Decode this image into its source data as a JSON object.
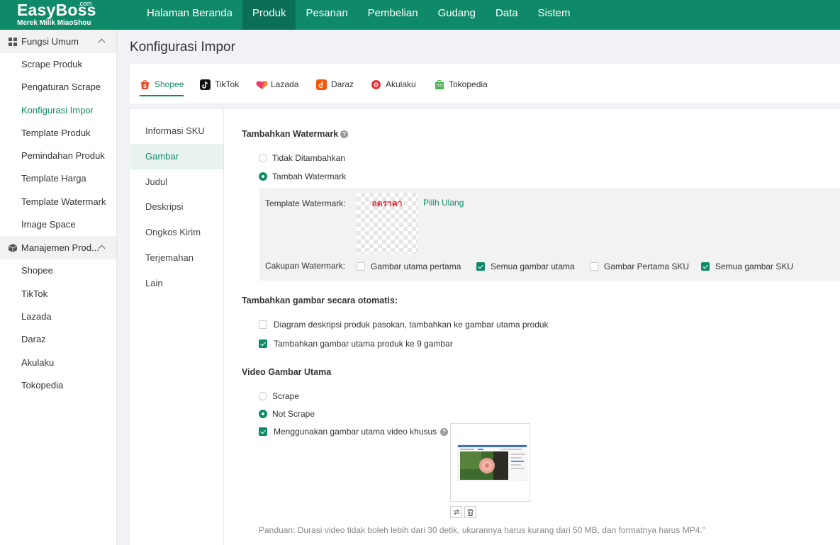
{
  "brand": {
    "name": "EasyBoss",
    "com": ".com",
    "subtitle": "Merek Milik MiaoShou"
  },
  "nav": [
    "Halaman Beranda",
    "Produk",
    "Pesanan",
    "Pembelian",
    "Gudang",
    "Data",
    "Sistem"
  ],
  "nav_active": "Produk",
  "sidebar": {
    "group1": {
      "label": "Fungsi Umum",
      "icon": "grid-icon",
      "items": [
        "Scrape Produk",
        "Pengaturan Scrape",
        "Konfigurasi Impor",
        "Template Produk",
        "Pemindahan Produk",
        "Template Harga",
        "Template Watermark",
        "Image Space"
      ]
    },
    "group2": {
      "label": "Manajemen Prod...",
      "icon": "box-icon",
      "items": [
        "Shopee",
        "TikTok",
        "Lazada",
        "Daraz",
        "Akulaku",
        "Tokopedia"
      ]
    },
    "active_item": "Konfigurasi Impor"
  },
  "page_title": "Konfigurasi Impor",
  "platform_tabs": [
    {
      "label": "Shopee",
      "icon": "shopee-icon",
      "color": "#ee4d2d"
    },
    {
      "label": "TikTok",
      "icon": "tiktok-icon",
      "color": "#111111"
    },
    {
      "label": "Lazada",
      "icon": "lazada-icon",
      "color": "#f5386f"
    },
    {
      "label": "Daraz",
      "icon": "daraz-icon",
      "color": "#f85606"
    },
    {
      "label": "Akulaku",
      "icon": "akulaku-icon",
      "color": "#e5323b"
    },
    {
      "label": "Tokopedia",
      "icon": "tokopedia-icon",
      "color": "#42b549"
    }
  ],
  "sub_nav": [
    "Informasi SKU",
    "Gambar",
    "Judul",
    "Deskripsi",
    "Ongkos Kirim",
    "Terjemahan",
    "Lain"
  ],
  "sub_nav_active": "Gambar",
  "watermark": {
    "title": "Tambahkan Watermark",
    "opt_none": "Tidak Ditambahkan",
    "opt_add": "Tambah Watermark",
    "selected": "Tambah Watermark",
    "template_label": "Template Watermark:",
    "template_text": "ลดราคา",
    "reselect": "Pilih Ulang",
    "scope_label": "Cakupan Watermark:",
    "scope_options": [
      {
        "label": "Gambar utama pertama",
        "checked": false
      },
      {
        "label": "Semua gambar utama",
        "checked": true
      },
      {
        "label": "Gambar Pertama SKU",
        "checked": false
      },
      {
        "label": "Semua gambar SKU",
        "checked": true
      }
    ]
  },
  "auto_images": {
    "title": "Tambahkan gambar secara otomatis:",
    "options": [
      {
        "label": "Diagram deskripsi produk pasokan, tambahkan ke gambar utama produk",
        "checked": false
      },
      {
        "label": "Tambahkan gambar utama produk ke 9 gambar",
        "checked": true
      }
    ]
  },
  "video": {
    "title": "Video Gambar Utama",
    "opt_scrape": "Scrape",
    "opt_not_scrape": "Not Scrape",
    "selected": "Not Scrape",
    "custom_label": "Menggunakan gambar utama video khusus",
    "custom_checked": true,
    "guide": "Panduan: Durasi video tidak boleh lebih dari 30 detik, ukurannya harus kurang dari 50 MB, dan formatnya harus MP4.\""
  },
  "colors": {
    "brand": "#0f8a69",
    "nav_active": "#0a6f55",
    "accent_red": "#e0313a"
  }
}
